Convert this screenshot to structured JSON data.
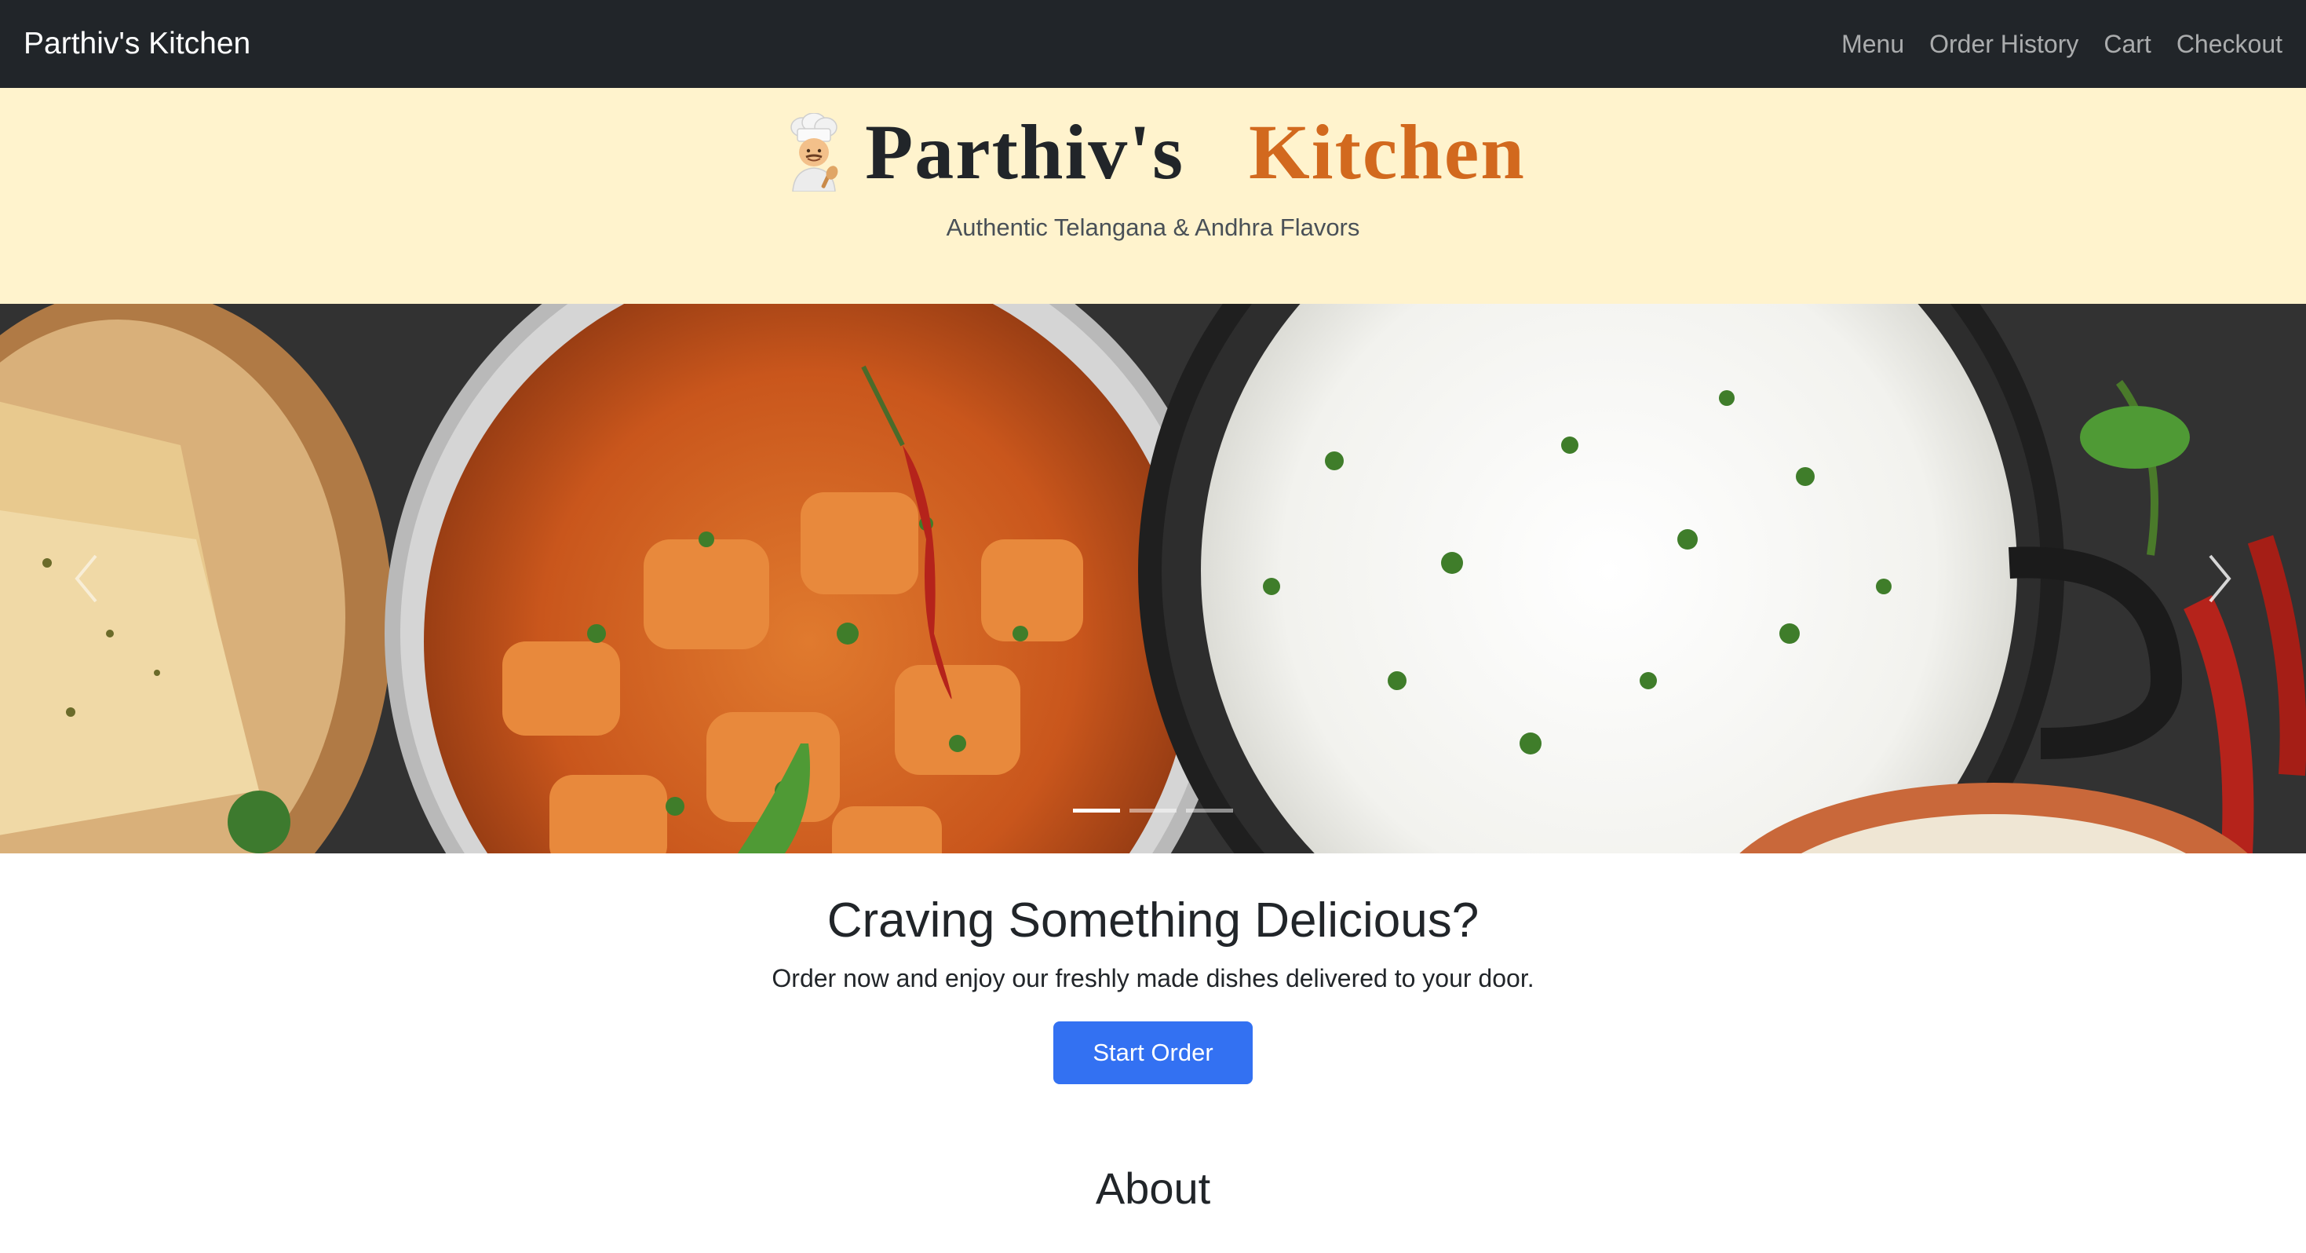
{
  "navbar": {
    "brand": "Parthiv's Kitchen",
    "links": [
      "Menu",
      "Order History",
      "Cart",
      "Checkout"
    ]
  },
  "header": {
    "icon": "chef-emoji-icon",
    "title_part1": "Parthiv's",
    "title_part2": "Kitchen",
    "tagline": "Authentic Telangana & Andhra Flavors",
    "accent_color": "#d2691e",
    "background_color": "#fff3cd"
  },
  "carousel": {
    "slides": 3,
    "active_index": 0,
    "prev_icon": "chevron-left-icon",
    "next_icon": "chevron-right-icon"
  },
  "cta": {
    "heading": "Craving Something Delicious?",
    "subtext": "Order now and enjoy our freshly made dishes delivered to your door.",
    "button_label": "Start Order",
    "button_color": "#3371f2"
  },
  "about": {
    "heading": "About"
  }
}
